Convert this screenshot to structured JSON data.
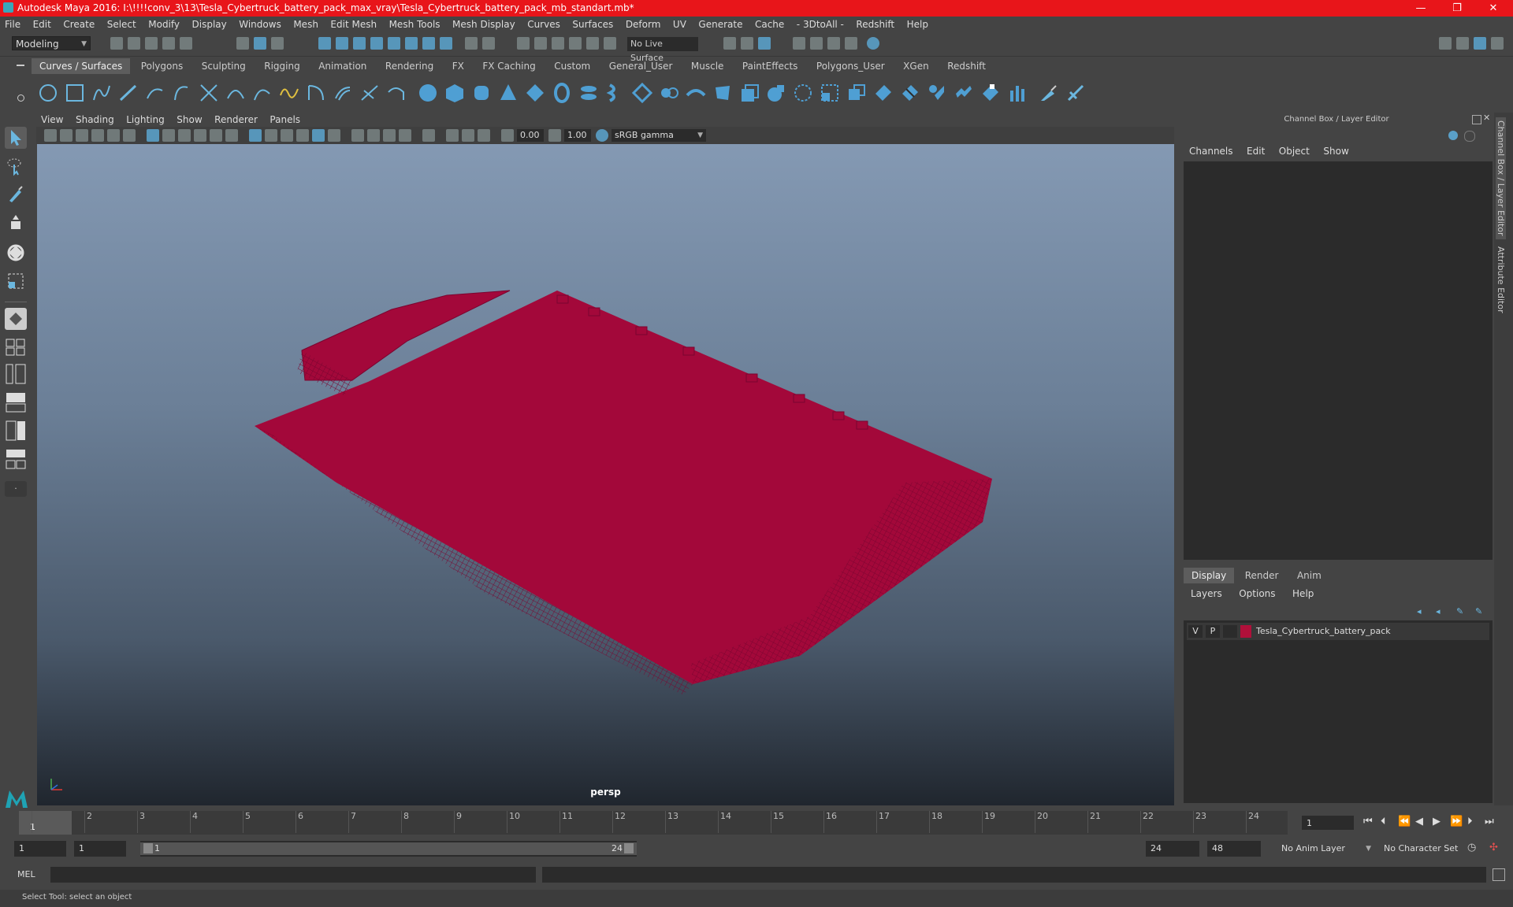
{
  "titlebar": {
    "title": "Autodesk Maya 2016: I:\\!!!!conv_3\\13\\Tesla_Cybertruck_battery_pack_max_vray\\Tesla_Cybertruck_battery_pack_mb_standart.mb*",
    "minimize": "—",
    "maximize": "❐",
    "close": "✕"
  },
  "menubar": [
    "File",
    "Edit",
    "Create",
    "Select",
    "Modify",
    "Display",
    "Windows",
    "Mesh",
    "Edit Mesh",
    "Mesh Tools",
    "Mesh Display",
    "Curves",
    "Surfaces",
    "Deform",
    "UV",
    "Generate",
    "Cache",
    "- 3DtoAll -",
    "Redshift",
    "Help"
  ],
  "statusline": {
    "mode": "Modeling",
    "live_surface": "No Live Surface"
  },
  "shelf_tabs": [
    "Curves / Surfaces",
    "Polygons",
    "Sculpting",
    "Rigging",
    "Animation",
    "Rendering",
    "FX",
    "FX Caching",
    "Custom",
    "General_User",
    "Muscle",
    "PaintEffects",
    "Polygons_User",
    "XGen",
    "Redshift"
  ],
  "shelf_active_tab": "Curves / Surfaces",
  "viewport": {
    "menu": [
      "View",
      "Shading",
      "Lighting",
      "Show",
      "Renderer",
      "Panels"
    ],
    "near_value": "0.00",
    "far_value": "1.00",
    "color_space": "sRGB gamma",
    "camera_label": "persp"
  },
  "channel_box": {
    "title": "Channel Box / Layer Editor",
    "menu": [
      "Channels",
      "Edit",
      "Object",
      "Show"
    ]
  },
  "layer_editor": {
    "tabs": [
      "Display",
      "Render",
      "Anim"
    ],
    "active_tab": "Display",
    "menu": [
      "Layers",
      "Options",
      "Help"
    ],
    "layer": {
      "visible": "V",
      "playback": "P",
      "name": "Tesla_Cybertruck_battery_pack",
      "color": "#b0103a"
    }
  },
  "side_tabs": {
    "channel_box": "Channel Box / Layer Editor",
    "attribute_editor": "Attribute Editor"
  },
  "timeline": {
    "ticks": [
      "1",
      "2",
      "3",
      "4",
      "5",
      "6",
      "7",
      "8",
      "9",
      "10",
      "11",
      "12",
      "13",
      "14",
      "15",
      "16",
      "17",
      "18",
      "19",
      "20",
      "21",
      "22",
      "23",
      "24"
    ],
    "current_frame": "1",
    "current_frame_field": "1"
  },
  "range": {
    "start": "1",
    "playback_start": "1",
    "slider_start": "1",
    "slider_end": "24",
    "playback_end": "24",
    "end": "48",
    "anim_layer": "No Anim Layer",
    "character_set": "No Character Set"
  },
  "command_line": {
    "label": "MEL"
  },
  "help_line": {
    "text": "Select Tool: select an object"
  },
  "colors": {
    "title_bar": "#e8151a",
    "wireframe": "#a3083a",
    "accent": "#5aa0c8"
  }
}
